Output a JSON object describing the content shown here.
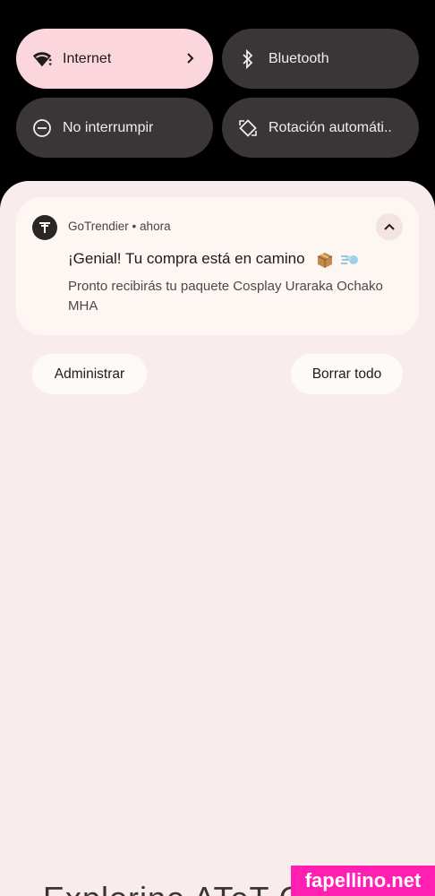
{
  "quick_settings": {
    "internet": {
      "label": "Internet",
      "icon": "wifi-icon",
      "state": "on"
    },
    "bluetooth": {
      "label": "Bluetooth",
      "icon": "bluetooth-icon",
      "state": "off"
    },
    "dnd": {
      "label": "No interrumpir",
      "icon": "dnd-icon",
      "state": "off"
    },
    "rotation": {
      "label": "Rotación automáti..",
      "icon": "rotate-icon",
      "state": "off"
    }
  },
  "notification": {
    "app_name": "GoTrendier",
    "time": "ahora",
    "separator": "•",
    "title": "¡Genial! Tu compra está en camino",
    "body": "Pronto recibirás tu paquete Cosplay Uraraka Ochako MHA",
    "title_emojis": [
      "package-icon",
      "dash-icon"
    ]
  },
  "actions": {
    "manage_label": "Administrar",
    "clear_all_label": "Borrar todo"
  },
  "footer": {
    "partial_text": "Explorine ATeT Q"
  },
  "watermark": {
    "text": "fapellino.net"
  },
  "colors": {
    "tile_on": "#fbd6dc",
    "tile_off": "#3a3536",
    "shade_bg": "#f9ecec",
    "card_bg": "#fdf6f3",
    "watermark_bg": "#ff1fb0"
  }
}
